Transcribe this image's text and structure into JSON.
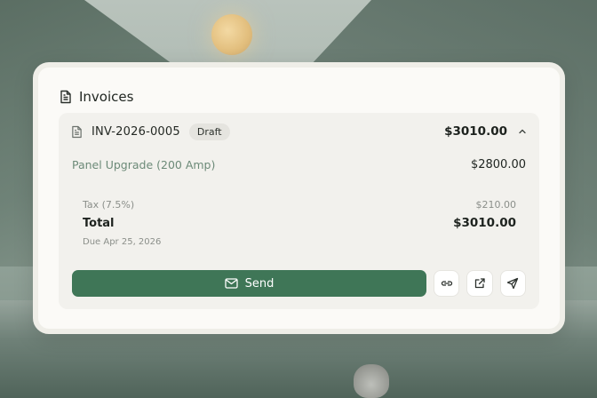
{
  "card": {
    "title": "Invoices",
    "icon": "document-icon"
  },
  "invoice": {
    "id": "INV-2026-0005",
    "status": "Draft",
    "total_display": "$3010.00",
    "expanded": true,
    "line_items": [
      {
        "name": "Panel Upgrade (200 Amp)",
        "amount": "$2800.00"
      }
    ],
    "tax_label": "Tax (7.5%)",
    "tax_amount": "$210.00",
    "total_label": "Total",
    "total_amount": "$3010.00",
    "due": "Due Apr 25, 2026"
  },
  "actions": {
    "send_label": "Send",
    "icons": [
      "mail-icon",
      "link-icon",
      "external-link-icon",
      "paper-plane-icon"
    ]
  },
  "colors": {
    "accent": "#3f7657",
    "card_bg": "#fbfaf7",
    "panel_bg": "#f2f1ed",
    "item_text": "#6c8a78"
  }
}
